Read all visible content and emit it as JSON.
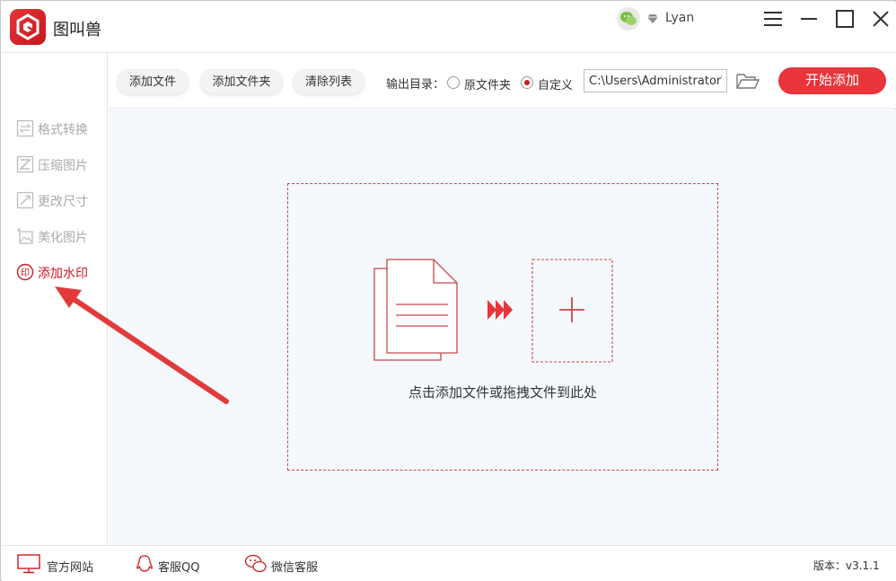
{
  "app": {
    "title": "图叫兽"
  },
  "user": {
    "name": "Lyan"
  },
  "sidebar": {
    "items": [
      {
        "label": "格式转换",
        "icon": "format-convert-icon"
      },
      {
        "label": "压缩图片",
        "icon": "compress-image-icon"
      },
      {
        "label": "更改尺寸",
        "icon": "resize-icon"
      },
      {
        "label": "美化图片",
        "icon": "beautify-image-icon"
      },
      {
        "label": "添加水印",
        "icon": "watermark-icon",
        "active": true
      }
    ]
  },
  "toolbar": {
    "add_file": "添加文件",
    "add_folder": "添加文件夹",
    "clear_list": "清除列表",
    "output_label": "输出目录：",
    "radio_original": "原文件夹",
    "radio_custom": "自定义",
    "selected_output": "自定义",
    "path_value": "C:\\Users\\Administrator\\Desktop",
    "start": "开始添加"
  },
  "dropzone": {
    "hint": "点击添加文件或拖拽文件到此处"
  },
  "statusbar": {
    "website": "官方网站",
    "qq": "客服QQ",
    "wechat": "微信客服",
    "version": "版本：v3.1.1"
  },
  "colors": {
    "accent": "#e8343a",
    "active_text": "#d0181f",
    "dashed_border": "#c8474c"
  }
}
